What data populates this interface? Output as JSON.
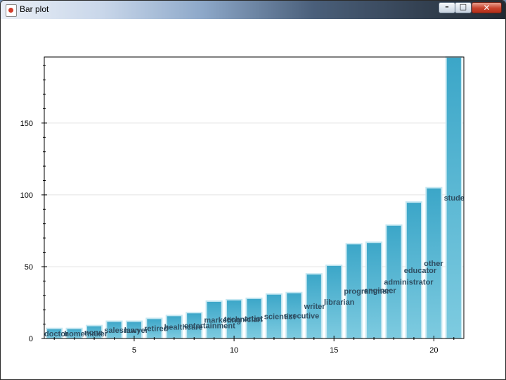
{
  "window": {
    "title": "Bar plot"
  },
  "icons": {
    "app": "java-cup-icon",
    "minimize": "minimize-icon",
    "maximize": "maximize-icon",
    "close": "close-icon"
  },
  "colors": {
    "bar_top": "#3ba6c8",
    "bar_bottom": "#7ecbe0",
    "bar_edge": "#c6e8f2",
    "label": "#2f4f63",
    "close_button": "#c8412b"
  },
  "chart_data": {
    "type": "bar",
    "title": "",
    "xlabel": "",
    "ylabel": "",
    "xlim": [
      0.5,
      21.5
    ],
    "ylim": [
      0,
      196
    ],
    "grid": true,
    "legend": "none",
    "x_ticks": [
      5,
      10,
      15,
      20
    ],
    "y_ticks": [
      0,
      50,
      100,
      150
    ],
    "bars": [
      {
        "x": 1,
        "value": 7,
        "label": "doctor"
      },
      {
        "x": 2,
        "value": 7,
        "label": "homemaker"
      },
      {
        "x": 3,
        "value": 9,
        "label": "none"
      },
      {
        "x": 4,
        "value": 12,
        "label": "salesman"
      },
      {
        "x": 5,
        "value": 12,
        "label": "lawyer"
      },
      {
        "x": 6,
        "value": 14,
        "label": "retired"
      },
      {
        "x": 7,
        "value": 16,
        "label": "healthcare"
      },
      {
        "x": 8,
        "value": 18,
        "label": "entertainment"
      },
      {
        "x": 9,
        "value": 26,
        "label": "marketing"
      },
      {
        "x": 10,
        "value": 27,
        "label": "technician"
      },
      {
        "x": 11,
        "value": 28,
        "label": "artist"
      },
      {
        "x": 12,
        "value": 31,
        "label": "scientist"
      },
      {
        "x": 13,
        "value": 32,
        "label": "executive"
      },
      {
        "x": 14,
        "value": 45,
        "label": "writer"
      },
      {
        "x": 15,
        "value": 51,
        "label": "librarian"
      },
      {
        "x": 16,
        "value": 66,
        "label": "programmer"
      },
      {
        "x": 17,
        "value": 67,
        "label": "engineer"
      },
      {
        "x": 18,
        "value": 79,
        "label": "administrator"
      },
      {
        "x": 19,
        "value": 95,
        "label": "educator"
      },
      {
        "x": 20,
        "value": 105,
        "label": "other"
      },
      {
        "x": 21,
        "value": 196,
        "label": "student"
      }
    ]
  }
}
